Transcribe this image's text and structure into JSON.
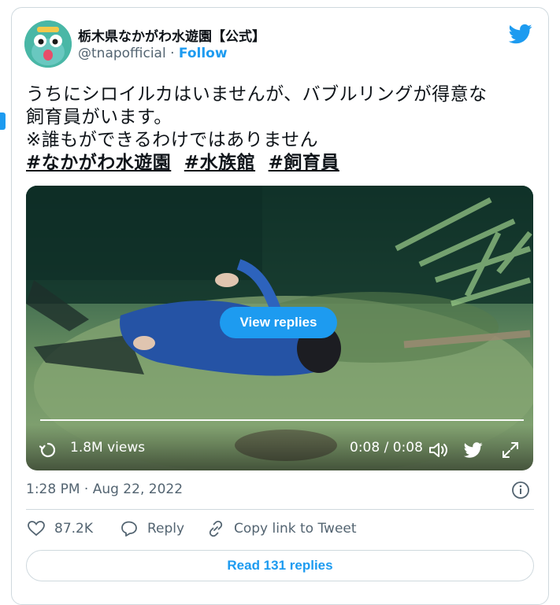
{
  "author": {
    "display_name": "栃木県なかがわ水遊園【公式】",
    "handle": "@tnapofficial",
    "separator": "·",
    "follow_label": "Follow"
  },
  "tweet": {
    "line1": "うちにシロイルカはいませんが、バブルリングが得意な",
    "line2": "飼育員がいます。",
    "line3": "※誰もができるわけではありません",
    "hashtags": [
      "#なかがわ水遊園",
      "#水族館",
      "#飼育員"
    ]
  },
  "video": {
    "view_replies_label": "View replies",
    "views": "1.8M views",
    "time": "0:08 / 0:08",
    "progress": 1.0
  },
  "meta": {
    "timestamp": "1:28 PM · Aug 22, 2022"
  },
  "actions": {
    "likes": "87.2K",
    "reply_label": "Reply",
    "copy_label": "Copy link to Tweet"
  },
  "read_replies_label": "Read 131 replies",
  "colors": {
    "accent": "#1d9bf0",
    "text": "#0f1419",
    "muted": "#536471",
    "border": "#cfd9de"
  },
  "icons": [
    "twitter-bird-icon",
    "replay-icon",
    "volume-icon",
    "fullscreen-icon",
    "info-icon",
    "heart-icon",
    "reply-icon",
    "link-icon"
  ]
}
